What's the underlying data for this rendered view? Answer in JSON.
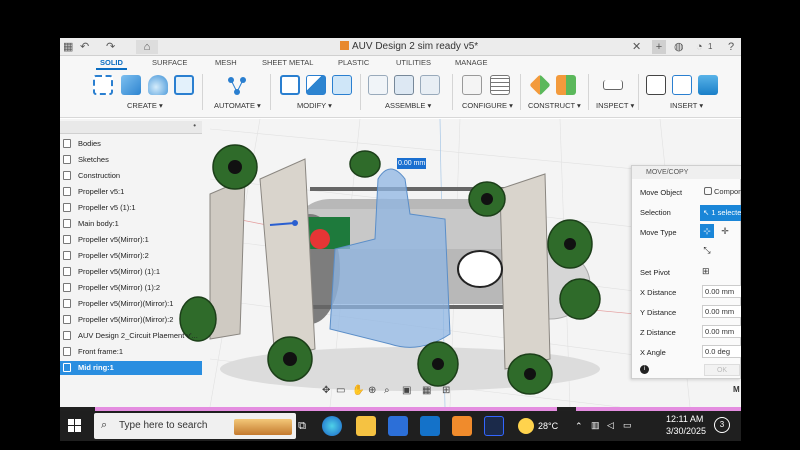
{
  "window": {
    "title": "AUV Design 2 sim ready v5*"
  },
  "ribbon": {
    "tabs": [
      "SOLID",
      "SURFACE",
      "MESH",
      "SHEET METAL",
      "PLASTIC",
      "UTILITIES",
      "MANAGE"
    ],
    "active_tab": "SOLID",
    "groups": [
      "CREATE ▾",
      "AUTOMATE ▾",
      "MODIFY ▾",
      "ASSEMBLE ▾",
      "CONFIGURE ▾",
      "CONSTRUCT ▾",
      "INSPECT ▾",
      "INSERT ▾"
    ]
  },
  "browser": {
    "items": [
      {
        "label": "Bodies",
        "selected": false
      },
      {
        "label": "Sketches",
        "selected": false
      },
      {
        "label": "Construction",
        "selected": false
      },
      {
        "label": "Propeller v5:1",
        "selected": false
      },
      {
        "label": "Propeller v5 (1):1",
        "selected": false
      },
      {
        "label": "Main body:1",
        "selected": false
      },
      {
        "label": "Propeller v5(Mirror):1",
        "selected": false
      },
      {
        "label": "Propeller v5(Mirror):2",
        "selected": false
      },
      {
        "label": "Propeller v5(Mirror) (1):1",
        "selected": false
      },
      {
        "label": "Propeller v5(Mirror) (1):2",
        "selected": false
      },
      {
        "label": "Propeller v5(Mirror)(Mirror):1",
        "selected": false
      },
      {
        "label": "Propeller v5(Mirror)(Mirror):2",
        "selected": false
      },
      {
        "label": "AUV Design 2_Circuit Plaement v'...",
        "selected": false
      },
      {
        "label": "Front frame:1",
        "selected": false
      },
      {
        "label": "Mid ring:1",
        "selected": true
      }
    ]
  },
  "viewport": {
    "distance_input": "0.00 mm"
  },
  "panel": {
    "title": "MOVE/COPY",
    "move_object_label": "Move Object",
    "move_object_value": "Compon",
    "selection_label": "Selection",
    "selection_value": "1 selecte",
    "move_type_label": "Move Type",
    "set_pivot_label": "Set Pivot",
    "x_distance_label": "X Distance",
    "x_distance_value": "0.00 mm",
    "y_distance_label": "Y Distance",
    "y_distance_value": "0.00 mm",
    "z_distance_label": "Z Distance",
    "z_distance_value": "0.00 mm",
    "x_angle_label": "X Angle",
    "x_angle_value": "0.0 deg",
    "ok_label": "OK"
  },
  "taskbar": {
    "search_placeholder": "Type here to search",
    "weather": "28°C",
    "time": "12:11 AM",
    "date": "3/30/2025",
    "notification_count": "3"
  },
  "colors": {
    "accent": "#0a6dc2",
    "selection": "#2a8ee0",
    "progress": "#e48de0"
  }
}
